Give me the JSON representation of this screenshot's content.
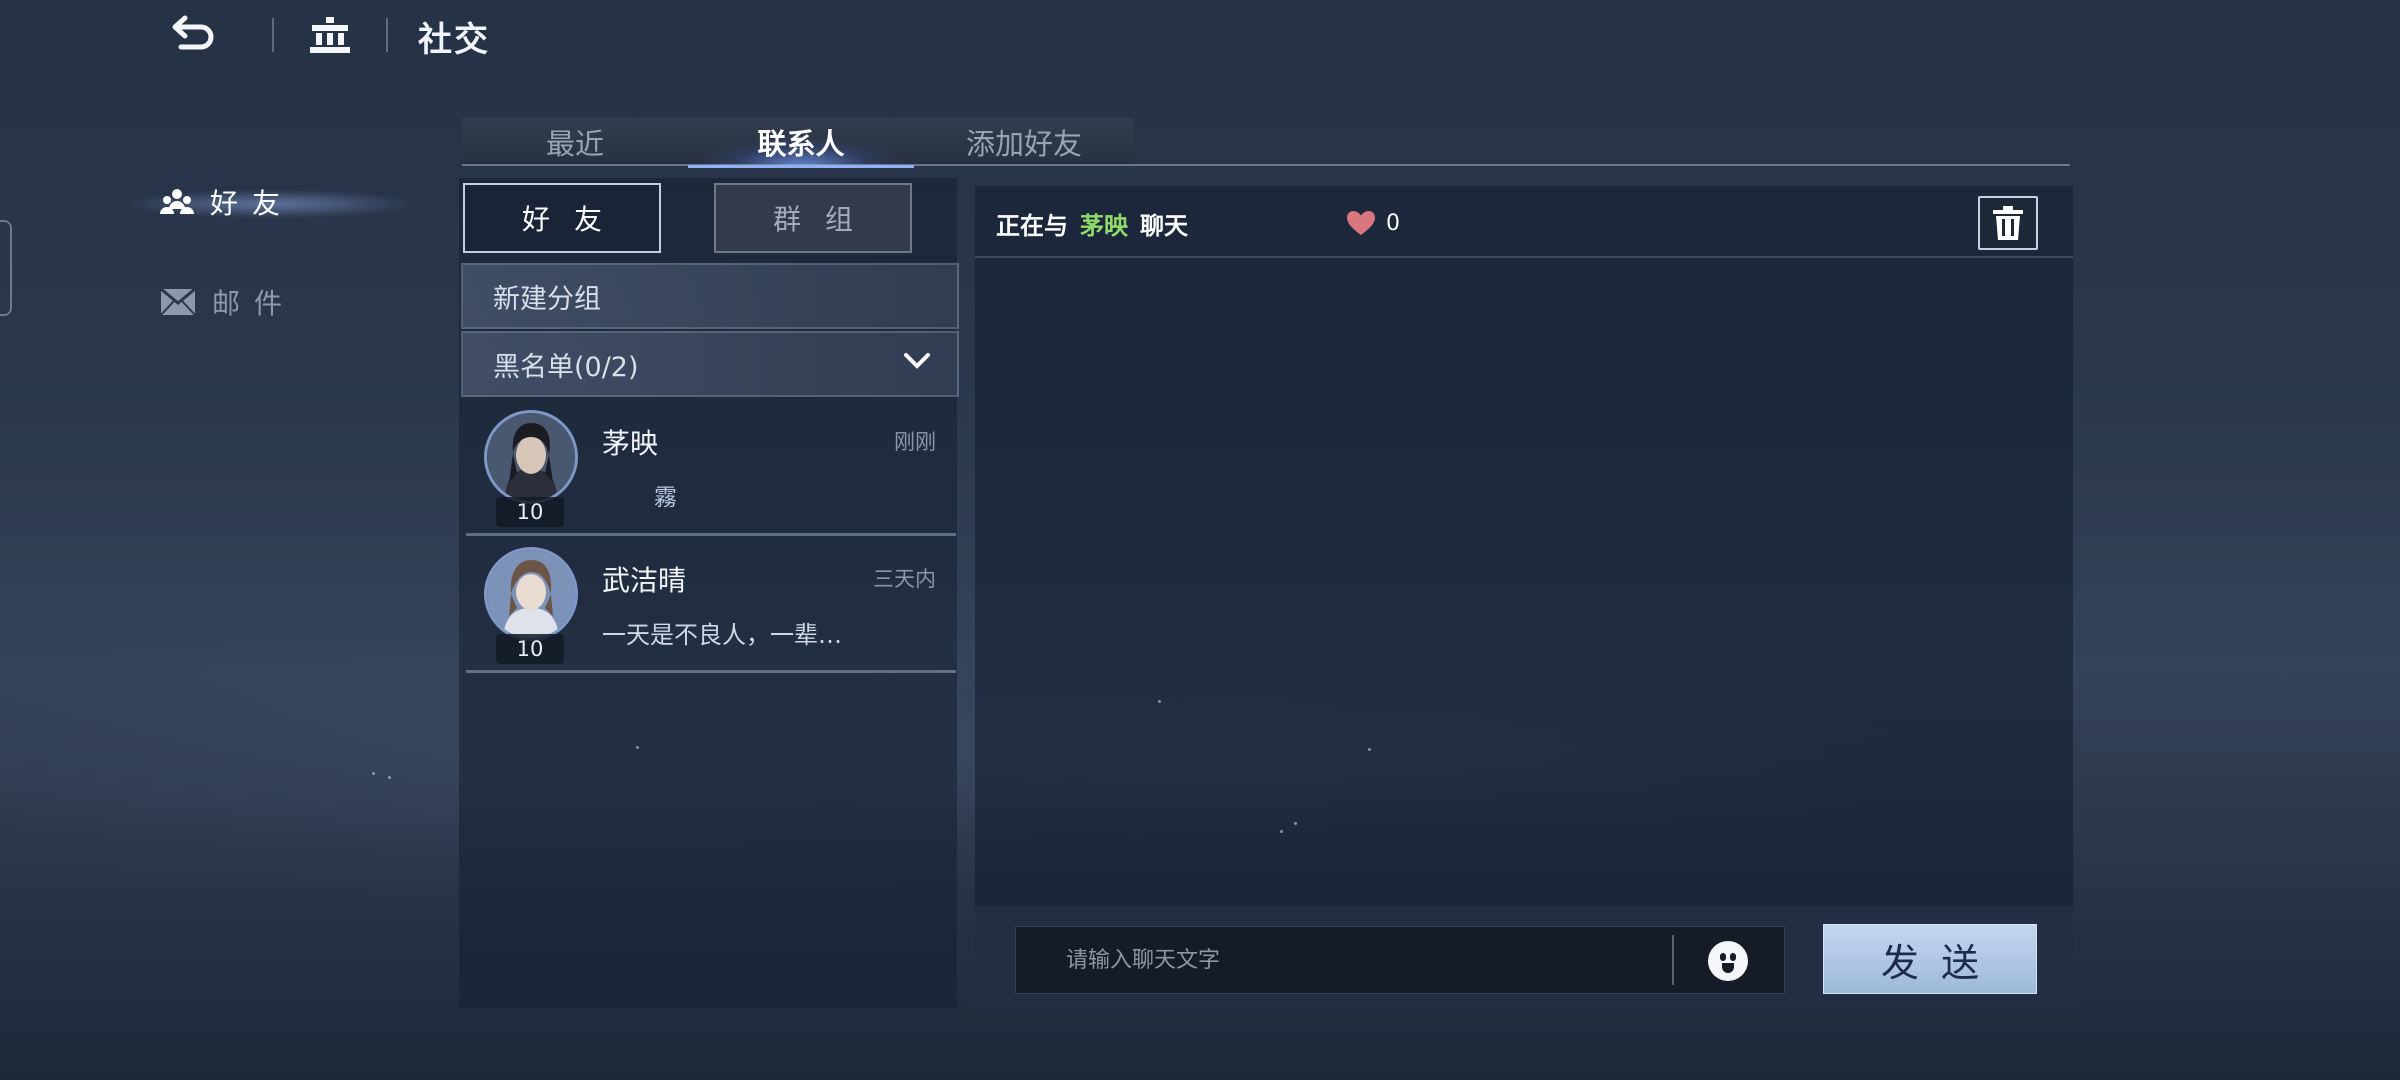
{
  "header": {
    "title": "社交"
  },
  "left_nav": [
    {
      "label": "好友",
      "active": true
    },
    {
      "label": "邮件",
      "active": false
    }
  ],
  "tabs": [
    {
      "label": "最近",
      "active": false
    },
    {
      "label": "联系人",
      "active": true
    },
    {
      "label": "添加好友",
      "active": false
    }
  ],
  "segments": [
    {
      "label": "好友",
      "active": true
    },
    {
      "label": "群组",
      "active": false
    }
  ],
  "list_actions": {
    "new_group": "新建分组",
    "blacklist": "黑名单(0/2)"
  },
  "contacts": [
    {
      "name": "茅映",
      "time": "刚刚",
      "message": "霧",
      "level": "10"
    },
    {
      "name": "武洁晴",
      "time": "三天内",
      "message": "一天是不良人，一辈…",
      "level": "10"
    }
  ],
  "chat": {
    "status_prefix": "正在与",
    "partner": "茅映",
    "status_suffix": "聊天",
    "affinity": "0",
    "input_placeholder": "请输入聊天文字",
    "send_label": "发送"
  },
  "colors": {
    "highlight_name": "#8fdc6a",
    "heart": "#d9777f",
    "active_tab_glow": "#8fb2ff"
  }
}
